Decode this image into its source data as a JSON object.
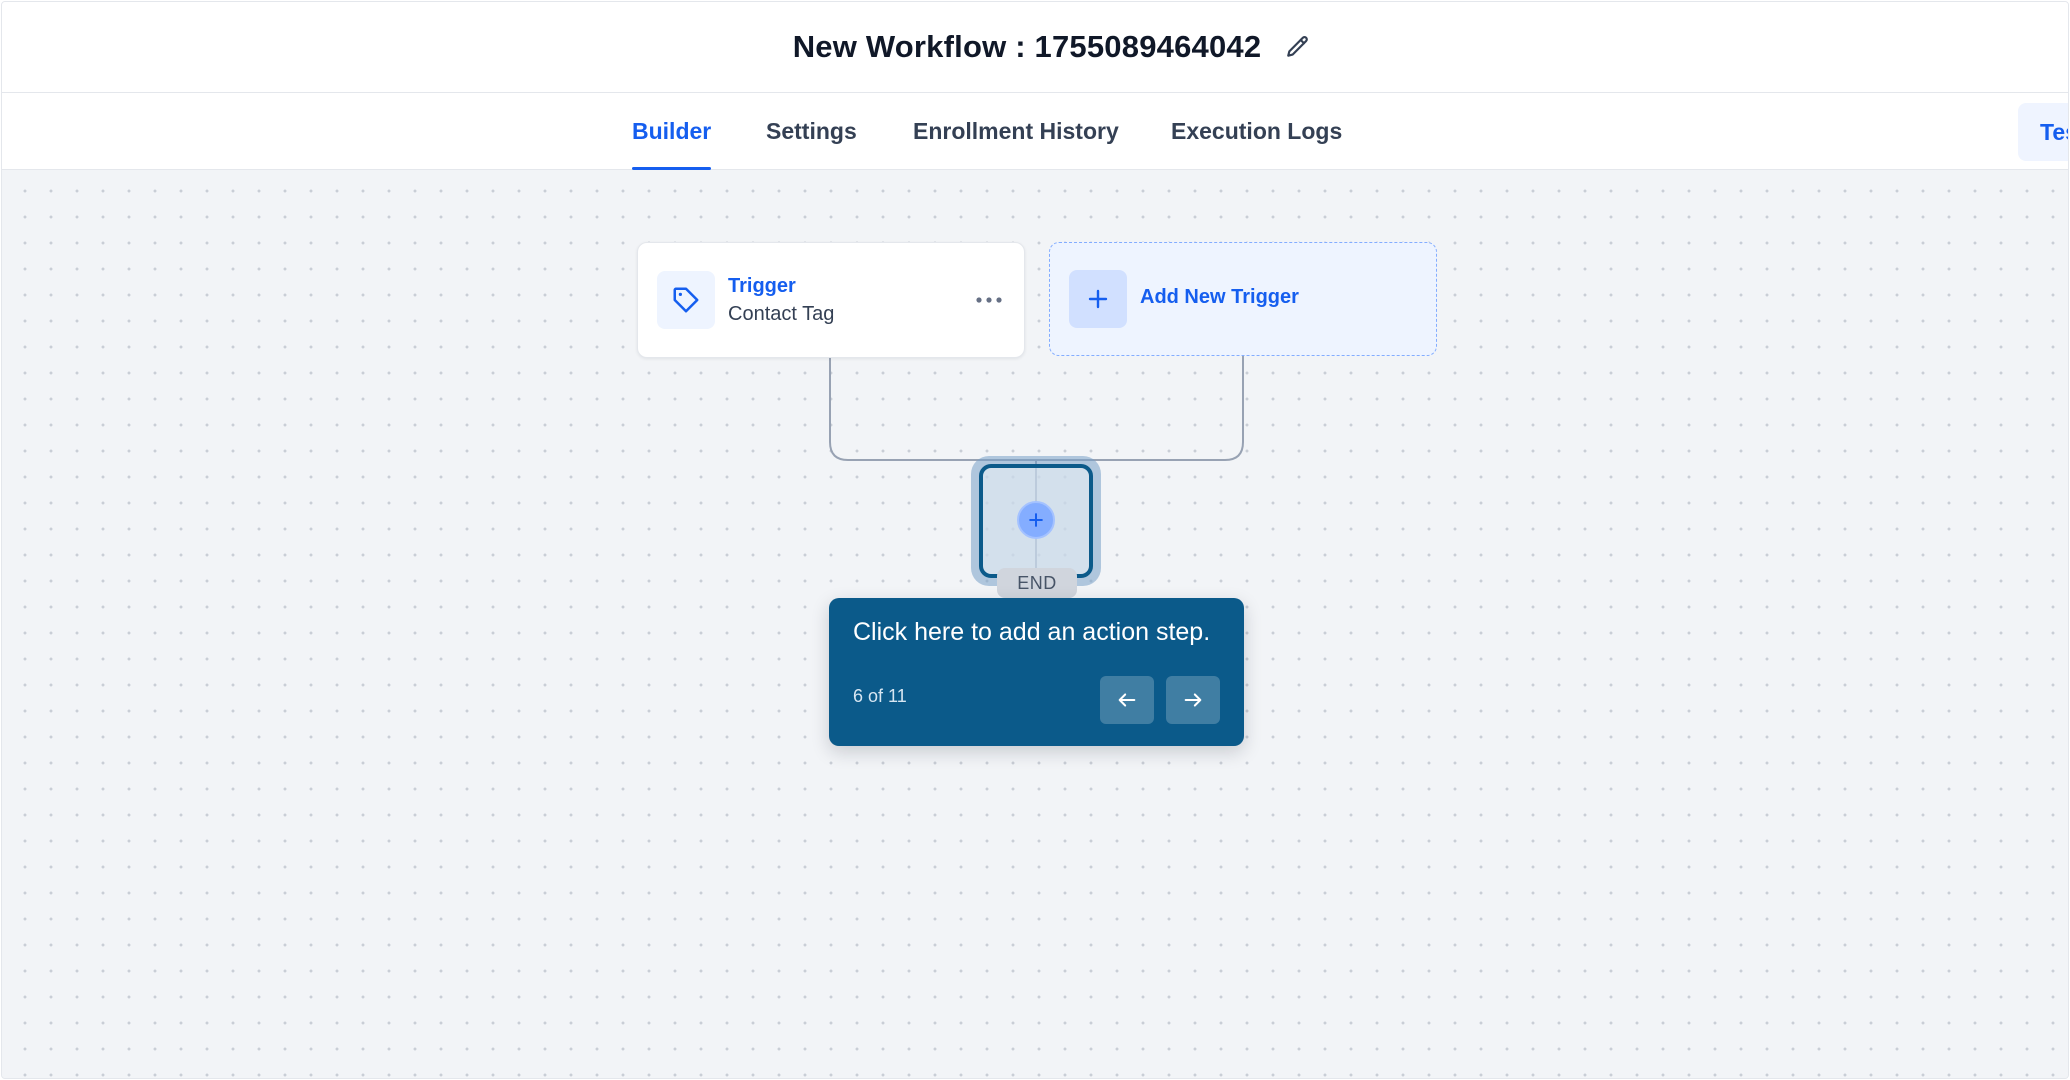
{
  "header": {
    "title": "New Workflow : 1755089464042",
    "edit_icon": "pencil-icon"
  },
  "tabs": [
    {
      "label": "Builder",
      "active": true
    },
    {
      "label": "Settings",
      "active": false
    },
    {
      "label": "Enrollment History",
      "active": false
    },
    {
      "label": "Execution Logs",
      "active": false
    }
  ],
  "toolbar": {
    "test_label": "Test"
  },
  "canvas": {
    "trigger": {
      "title": "Trigger",
      "subtitle": "Contact Tag",
      "icon": "tag-icon",
      "menu_icon": "more-horizontal-icon"
    },
    "add_trigger": {
      "label": "Add New Trigger",
      "icon": "plus-icon"
    },
    "add_step_icon": "plus-icon",
    "end_label": "END"
  },
  "tour": {
    "text": "Click here to add an action step.",
    "step": "6 of 11",
    "prev_icon": "arrow-left-icon",
    "next_icon": "arrow-right-icon"
  },
  "colors": {
    "accent": "#155eef",
    "tooltip_bg": "#0b5a8a",
    "canvas_bg": "#f2f4f7"
  }
}
